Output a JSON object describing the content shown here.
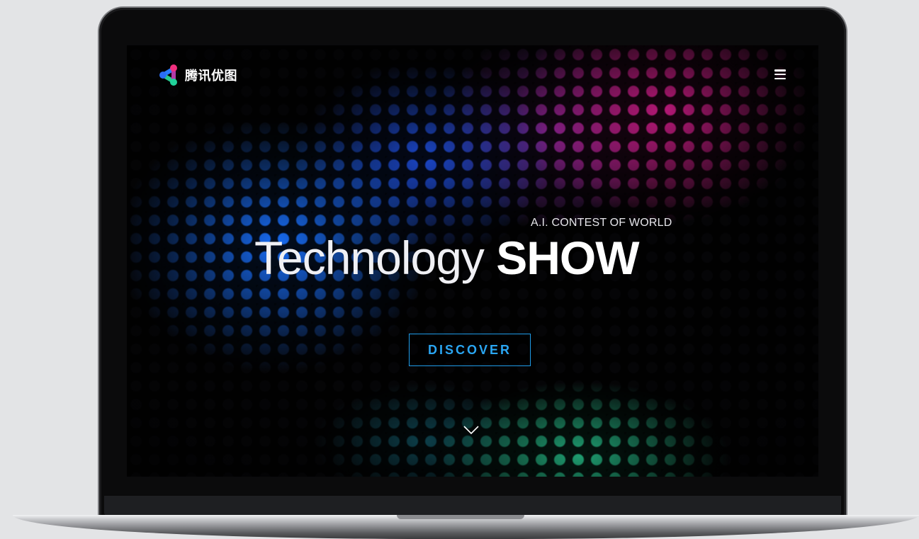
{
  "header": {
    "brand_name": "腾讯优图",
    "logo_icon": "tencent-youtu-logo",
    "menu_icon": "hamburger-menu-icon"
  },
  "hero": {
    "subtitle": "A.I. CONTEST OF WORLD",
    "title_light": "Technology",
    "title_bold": "SHOW",
    "cta_label": "DISCOVER",
    "scroll_icon": "chevron-down-icon"
  },
  "colors": {
    "background": "#e3e4e6",
    "cta_accent": "#1e9be8",
    "pattern_blue": "#1870ff",
    "pattern_pink": "#e61e96",
    "pattern_green": "#28d296"
  }
}
